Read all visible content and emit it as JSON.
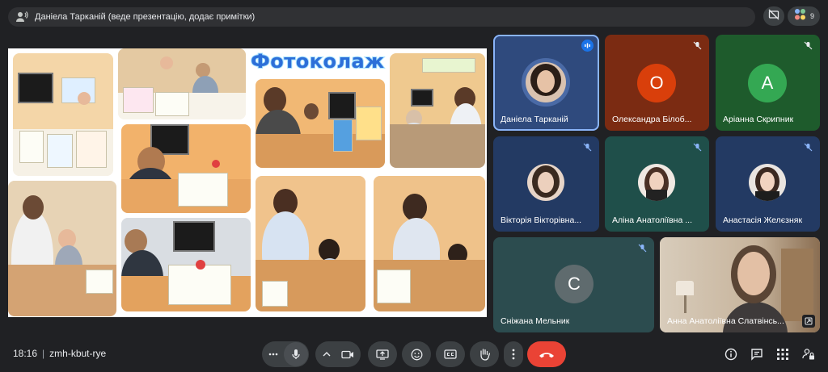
{
  "presenter_bar": {
    "text": "Даніела Тарканій (веде презентацію, додає примітки)",
    "icon": "presenting-person-icon"
  },
  "top_controls": {
    "hide_icon": "presentation-hidden-icon",
    "participant_count": "9"
  },
  "slide": {
    "title": "Фотоколаж"
  },
  "participants": [
    {
      "name": "Даніела Тарканій",
      "avatar": "photo",
      "mic": "active-presenter",
      "bg": "#2f4a7d"
    },
    {
      "name": "Олександра Білоб...",
      "avatar": "letter",
      "letter": "О",
      "avatar_color": "#d93f0b",
      "bg": "#7b2b12",
      "mic": "muted"
    },
    {
      "name": "Аріанна Скрипник",
      "avatar": "letter",
      "letter": "А",
      "avatar_color": "#34a853",
      "bg": "#1e5b2c",
      "mic": "muted"
    },
    {
      "name": "Вікторія Вікторівна...",
      "avatar": "photo",
      "bg": "#233a63",
      "mic": "muted"
    },
    {
      "name": "Аліна Анатоліївна ...",
      "avatar": "photo",
      "bg": "#1f4f4a",
      "mic": "muted"
    },
    {
      "name": "Анастасія Желєзняк",
      "avatar": "photo",
      "bg": "#233a63",
      "mic": "muted"
    },
    {
      "name": "Сніжана Мельник",
      "avatar": "letter",
      "letter": "С",
      "avatar_color": "#5f6b6e",
      "bg": "#2c4c4f",
      "mic": "muted"
    },
    {
      "name": "Анна Анатоліївна Слатвінсь...",
      "avatar": "video",
      "bg": "#c9b9a4",
      "mic": "none"
    }
  ],
  "meeting": {
    "time": "18:16",
    "code": "zmh-kbut-rye"
  },
  "colors": {
    "background": "#202124",
    "control": "#3c4043",
    "end_call": "#ea4335",
    "presenter_border": "#8ab4f8"
  }
}
